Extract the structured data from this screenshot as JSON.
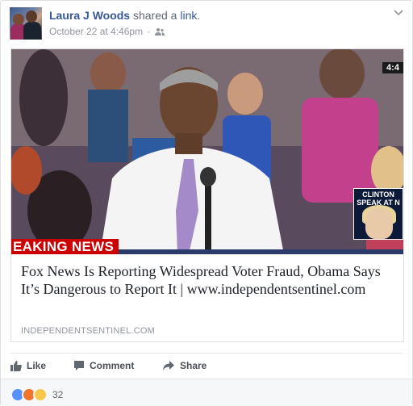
{
  "post": {
    "author": "Laura J Woods",
    "verb": "shared a",
    "verb_link": "link",
    "verb_end": ".",
    "timestamp": "October 22 at 4:46pm",
    "separator": "·",
    "audience_icon": "friends-icon",
    "menu_icon": "chevron-down-icon"
  },
  "link_card": {
    "image_overlay_left": "EAKING NEWS",
    "image_overlay_corner": "4:4",
    "image_inset_label": "CLINTON SPEAK AT N",
    "title": "Fox News Is Reporting Widespread Voter Fraud, Obama Says It’s Dangerous to Report It | www.independentsentinel.com",
    "domain": "INDEPENDENTSENTINEL.COM"
  },
  "actions": {
    "like": "Like",
    "comment": "Comment",
    "share": "Share"
  },
  "reactions": {
    "types": [
      "like",
      "angry",
      "wow"
    ],
    "count": "32"
  },
  "colors": {
    "link_blue": "#365899",
    "meta_gray": "#90949c",
    "breaking_red": "#cc0000"
  }
}
